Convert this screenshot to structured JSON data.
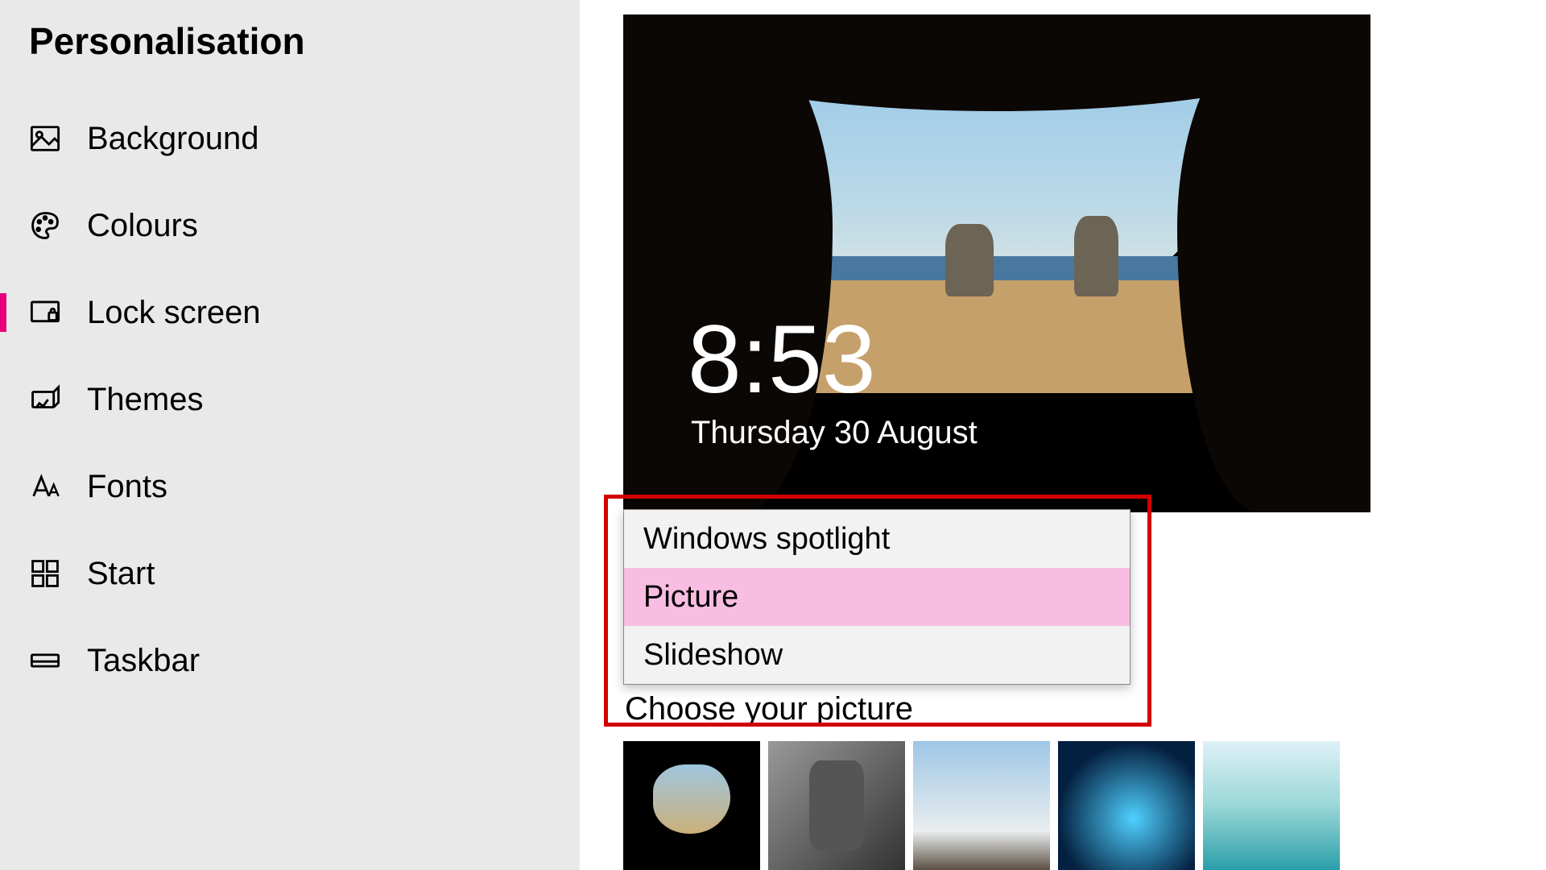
{
  "sidebar": {
    "title": "Personalisation",
    "items": [
      {
        "label": "Background"
      },
      {
        "label": "Colours"
      },
      {
        "label": "Lock screen"
      },
      {
        "label": "Themes"
      },
      {
        "label": "Fonts"
      },
      {
        "label": "Start"
      },
      {
        "label": "Taskbar"
      }
    ],
    "selected_index": 2
  },
  "preview": {
    "time": "8:53",
    "date": "Thursday 30 August"
  },
  "dropdown": {
    "options": [
      "Windows spotlight",
      "Picture",
      "Slideshow"
    ],
    "selected_index": 1
  },
  "choose_picture_label": "Choose your picture",
  "thumbnails": [
    {
      "name": "cave-beach"
    },
    {
      "name": "bw-portrait"
    },
    {
      "name": "mountain-sky"
    },
    {
      "name": "ice-cave"
    },
    {
      "name": "lagoon"
    }
  ],
  "colors": {
    "accent": "#e40078",
    "dropdown_selected": "#f9bde1",
    "highlight_border": "#d20000"
  }
}
